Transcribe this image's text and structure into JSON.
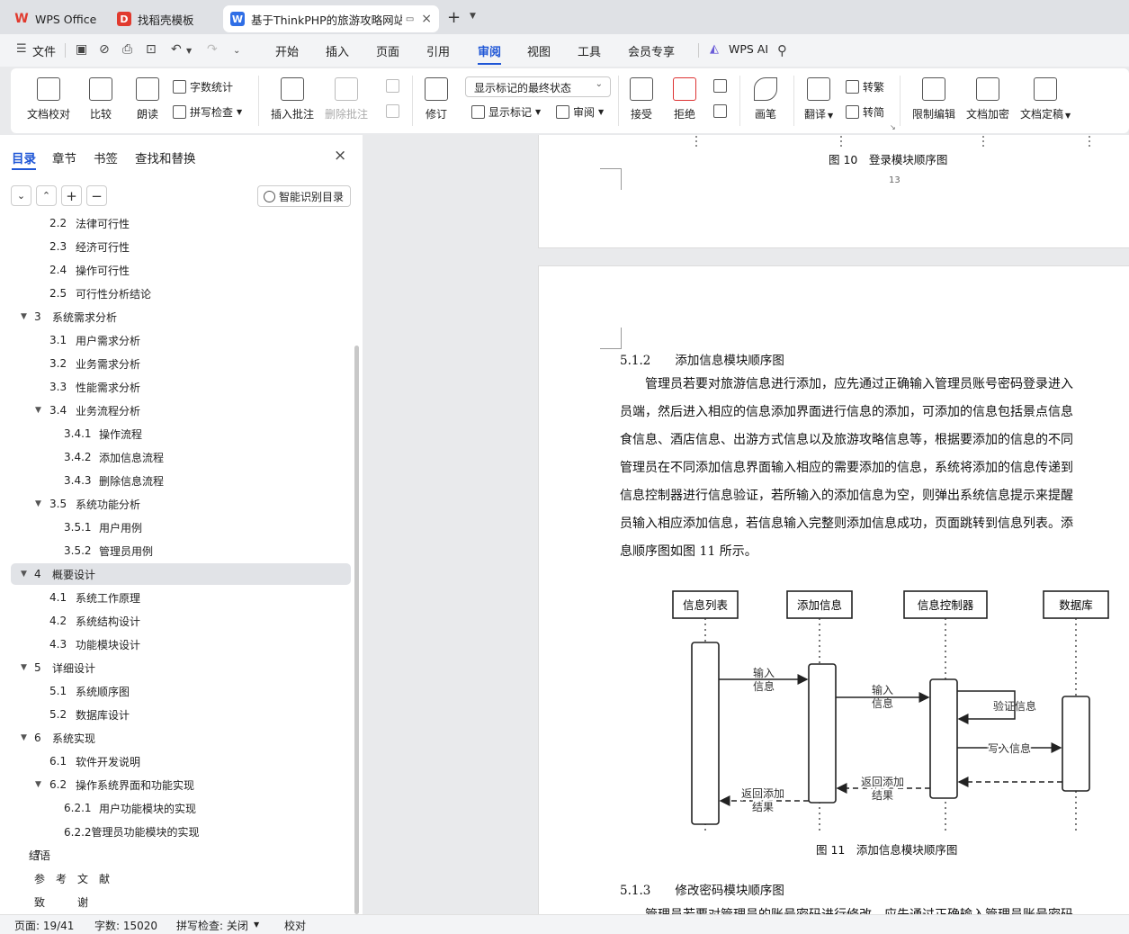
{
  "tabs": [
    {
      "label": "WPS Office",
      "icon": "wps-logo-icon",
      "color": "#e13a2e"
    },
    {
      "label": "找稻壳模板",
      "icon": "docer-logo-icon",
      "color": "#e13a2e"
    },
    {
      "label": "基于ThinkPHP的旅游攻略网站",
      "icon": "word-doc-icon",
      "color": "#2f6ee6"
    }
  ],
  "menu": {
    "file": "文件",
    "items": [
      "开始",
      "插入",
      "页面",
      "引用",
      "审阅",
      "视图",
      "工具",
      "会员专享"
    ],
    "active": "审阅",
    "ai": "WPS AI"
  },
  "ribbon": {
    "proofread": "文档校对",
    "compare": "比较",
    "read_aloud": "朗读",
    "word_count": "字数统计",
    "spell_check": "拼写检查",
    "insert_comment": "插入批注",
    "delete_comment": "删除批注",
    "revise": "修订",
    "markup_state": "显示标记的最终状态",
    "show_markup": "显示标记",
    "review": "审阅",
    "accept": "接受",
    "reject": "拒绝",
    "pen": "画笔",
    "translate": "翻译",
    "to_traditional": "转繁",
    "to_simplified": "转简",
    "restrict_edit": "限制编辑",
    "encrypt": "文档加密",
    "finalize": "文档定稿"
  },
  "sidebar": {
    "tabs": [
      "目录",
      "章节",
      "书签",
      "查找和替换"
    ],
    "smart_toc": "智能识别目录",
    "toc": [
      {
        "num": "2.2",
        "title": "法律可行性",
        "level": 2,
        "arrow": false
      },
      {
        "num": "2.3",
        "title": "经济可行性",
        "level": 2,
        "arrow": false
      },
      {
        "num": "2.4",
        "title": "操作可行性",
        "level": 2,
        "arrow": false
      },
      {
        "num": "2.5",
        "title": "可行性分析结论",
        "level": 2,
        "arrow": false
      },
      {
        "num": "3",
        "title": "系统需求分析",
        "level": 1,
        "arrow": true
      },
      {
        "num": "3.1",
        "title": "用户需求分析",
        "level": 2,
        "arrow": false
      },
      {
        "num": "3.2",
        "title": "业务需求分析",
        "level": 2,
        "arrow": false
      },
      {
        "num": "3.3",
        "title": "性能需求分析",
        "level": 2,
        "arrow": false
      },
      {
        "num": "3.4",
        "title": "业务流程分析",
        "level": 2,
        "arrow": true
      },
      {
        "num": "3.4.1",
        "title": "操作流程",
        "level": 3,
        "arrow": false
      },
      {
        "num": "3.4.2",
        "title": "添加信息流程",
        "level": 3,
        "arrow": false
      },
      {
        "num": "3.4.3",
        "title": "删除信息流程",
        "level": 3,
        "arrow": false
      },
      {
        "num": "3.5",
        "title": "系统功能分析",
        "level": 2,
        "arrow": true
      },
      {
        "num": "3.5.1",
        "title": "用户用例",
        "level": 3,
        "arrow": false
      },
      {
        "num": "3.5.2",
        "title": "管理员用例",
        "level": 3,
        "arrow": false
      },
      {
        "num": "4",
        "title": "概要设计",
        "level": 1,
        "arrow": true,
        "highlight": true
      },
      {
        "num": "4.1",
        "title": "系统工作原理",
        "level": 2,
        "arrow": false
      },
      {
        "num": "4.2",
        "title": "系统结构设计",
        "level": 2,
        "arrow": false
      },
      {
        "num": "4.3",
        "title": "功能模块设计",
        "level": 2,
        "arrow": false
      },
      {
        "num": "5",
        "title": "详细设计",
        "level": 1,
        "arrow": true
      },
      {
        "num": "5.1",
        "title": "系统顺序图",
        "level": 2,
        "arrow": false
      },
      {
        "num": "5.2",
        "title": "数据库设计",
        "level": 2,
        "arrow": false
      },
      {
        "num": "6",
        "title": "系统实现",
        "level": 1,
        "arrow": true
      },
      {
        "num": "6.1",
        "title": "软件开发说明",
        "level": 2,
        "arrow": false
      },
      {
        "num": "6.2",
        "title": "操作系统界面和功能实现",
        "level": 2,
        "arrow": true
      },
      {
        "num": "6.2.1",
        "title": "用户功能模块的实现",
        "level": 3,
        "arrow": false
      },
      {
        "num": "",
        "title": "6.2.2管理员功能模块的实现",
        "level": 3,
        "arrow": false
      },
      {
        "num": "7",
        "title": "结语",
        "level": 0,
        "arrow": false
      },
      {
        "num": "",
        "title": "参　考　文　献",
        "level": 0,
        "arrow": false
      },
      {
        "num": "",
        "title": "致　　　谢",
        "level": 0,
        "arrow": false
      }
    ]
  },
  "document": {
    "fig10_caption": "图 10　登录模块顺序图",
    "page_number": "13",
    "sec512": "5.1.2　　添加信息模块顺序图",
    "para_lines": [
      "　　管理员若要对旅游信息进行添加，应先通过正确输入管理员账号密码登录进入",
      "员端，然后进入相应的信息添加界面进行信息的添加，可添加的信息包括景点信息",
      "食信息、酒店信息、出游方式信息以及旅游攻略信息等，根据要添加的信息的不同",
      "管理员在不同添加信息界面输入相应的需要添加的信息，系统将添加的信息传递到",
      "信息控制器进行信息验证，若所输入的添加信息为空，则弹出系统信息提示来提醒",
      "员输入相应添加信息，若信息输入完整则添加信息成功，页面跳转到信息列表。添",
      "息顺序图如图 11 所示。"
    ],
    "diagram": {
      "actors": [
        "信息列表",
        "添加信息",
        "信息控制器",
        "数据库"
      ],
      "msg_input1": [
        "输入",
        "信息"
      ],
      "msg_input2": [
        "输入",
        "信息"
      ],
      "msg_verify": "验证信息",
      "msg_write": "写入信息",
      "msg_return1": [
        "返回添加",
        "结果"
      ],
      "msg_return2": [
        "返回添加",
        "结果"
      ]
    },
    "fig11_caption": "图 11　添加信息模块顺序图",
    "sec513": "5.1.3　　修改密码模块顺序图",
    "para2_line": "　　管理员若要对管理员的账号密码进行修改，应先通过正确输入管理员账号密码"
  },
  "status": {
    "page": "页面: 19/41",
    "words": "字数: 15020",
    "spell": "拼写检查: 关闭",
    "proof": "校对"
  }
}
